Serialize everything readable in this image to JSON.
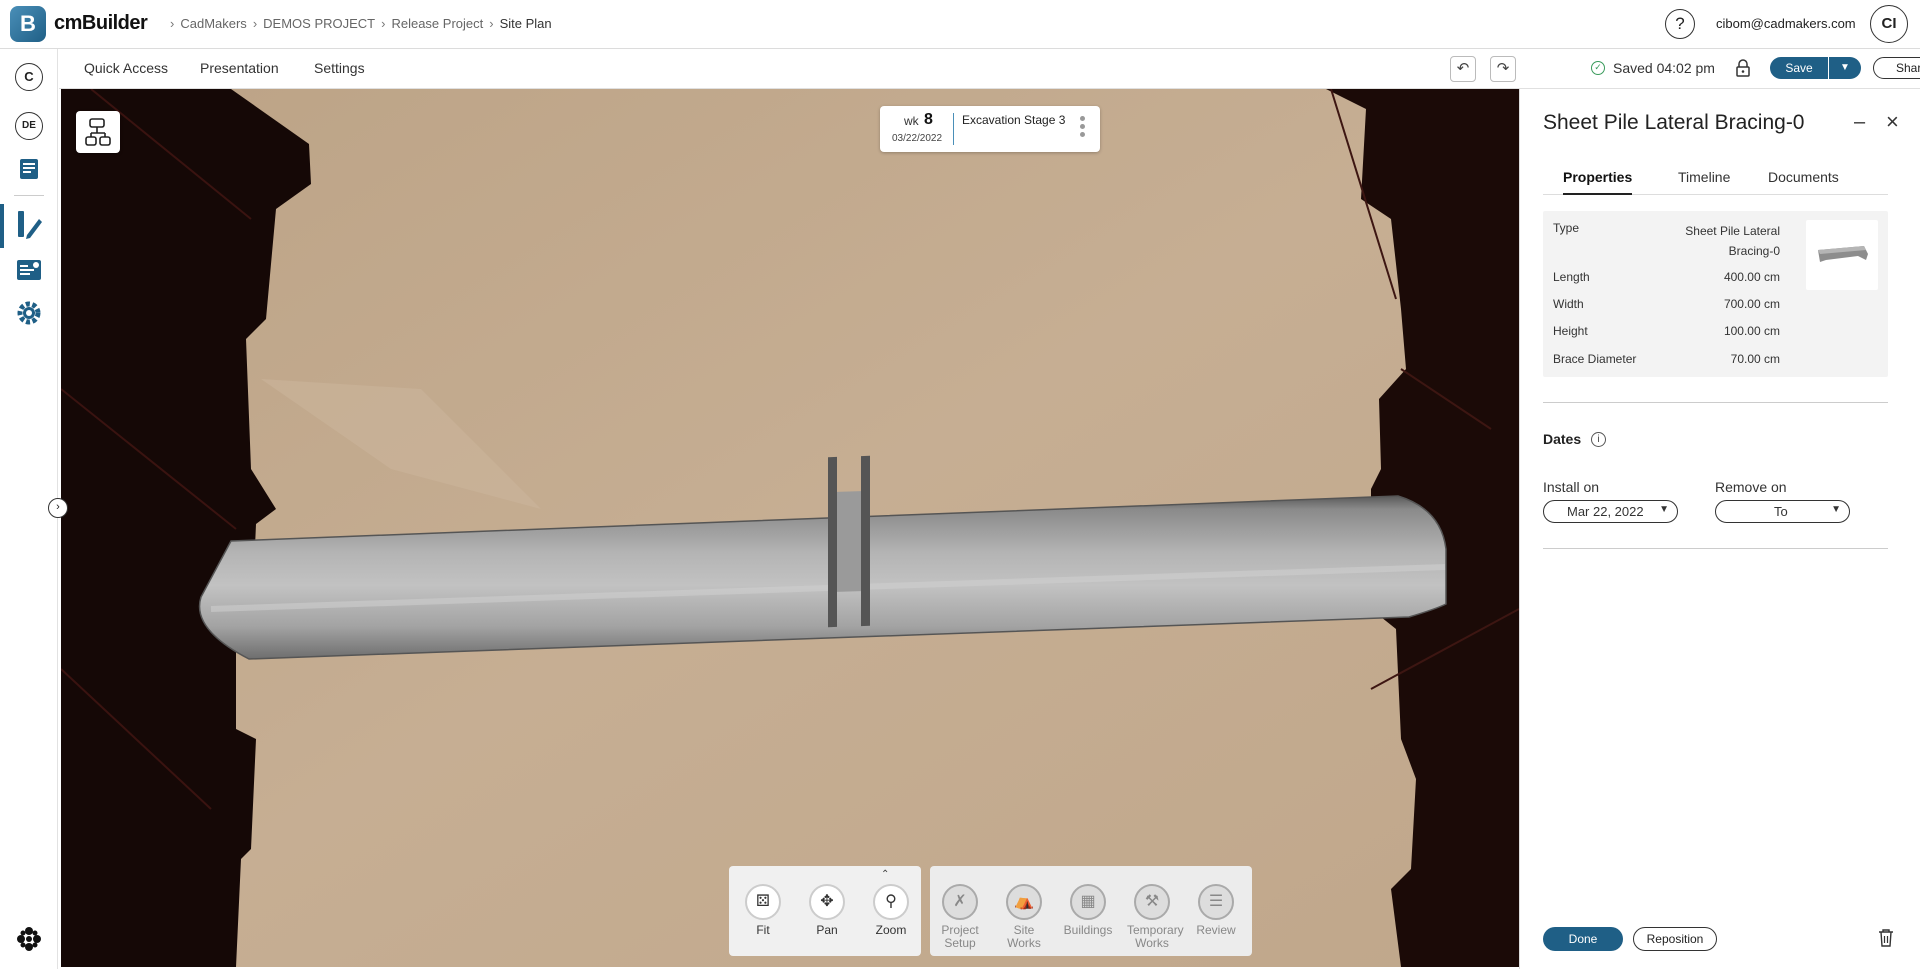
{
  "app": {
    "logo_letter": "B",
    "name": "cmBuilder"
  },
  "breadcrumb": [
    "CadMakers",
    "DEMOS PROJECT",
    "Release Project",
    "Site Plan"
  ],
  "header": {
    "help": "?",
    "email": "cibom@cadmakers.com",
    "avatar": "CI"
  },
  "sidebar": {
    "top_circle": "C",
    "project_badge": "DE"
  },
  "menu": {
    "quick_access": "Quick Access",
    "presentation": "Presentation",
    "settings": "Settings"
  },
  "toolbar": {
    "saved_text": "Saved 04:02 pm",
    "save_label": "Save",
    "share_label": "Share"
  },
  "stage": {
    "wk_label": "wk",
    "wk_number": "8",
    "date": "03/22/2022",
    "name": "Excavation Stage 3"
  },
  "nav_tools": [
    {
      "label": "Fit",
      "icon": "fit-icon"
    },
    {
      "label": "Pan",
      "icon": "pan-icon"
    },
    {
      "label": "Zoom",
      "icon": "zoom-icon"
    }
  ],
  "category_tools": [
    {
      "label": "Project Setup",
      "icon": "project-setup-icon"
    },
    {
      "label": "Site Works",
      "icon": "site-works-icon"
    },
    {
      "label": "Buildings",
      "icon": "buildings-icon"
    },
    {
      "label": "Temporary Works",
      "icon": "temporary-works-icon"
    },
    {
      "label": "Review",
      "icon": "review-icon"
    }
  ],
  "panel": {
    "title": "Sheet Pile Lateral Bracing-0",
    "tabs": [
      "Properties",
      "Timeline",
      "Documents"
    ],
    "active_tab": "Properties",
    "properties": {
      "type_label": "Type",
      "type_value": "Sheet Pile Lateral Bracing-0",
      "length_label": "Length",
      "length_value": "400.00 cm",
      "width_label": "Width",
      "width_value": "700.00 cm",
      "height_label": "Height",
      "height_value": "100.00 cm",
      "brace_label": "Brace Diameter",
      "brace_value": "70.00 cm"
    },
    "dates": {
      "title": "Dates",
      "install_label": "Install on",
      "install_value": "Mar 22, 2022",
      "remove_label": "Remove on",
      "remove_value": "To"
    },
    "done_label": "Done",
    "reposition_label": "Reposition"
  },
  "colors": {
    "brand": "#1f5f86",
    "ground": "#c4ab8f",
    "walls": "#1a0a08",
    "saved": "#3a9b5c"
  }
}
